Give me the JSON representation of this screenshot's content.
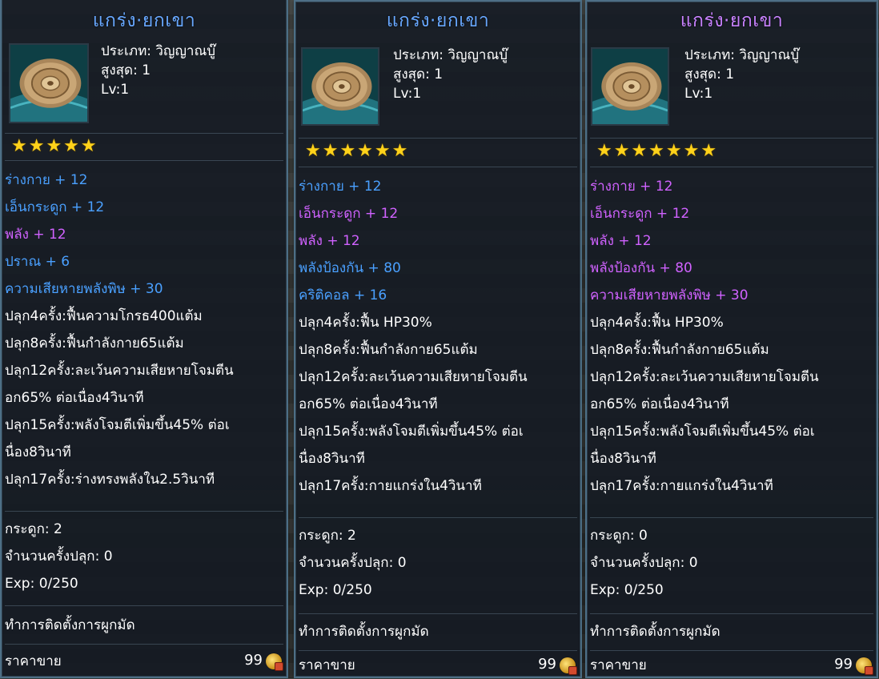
{
  "colors": {
    "blue": "#4aa0ff",
    "purple": "#d062ff",
    "white": "#ffffff",
    "star": "#ffd21a",
    "title_purple": "#c882ff",
    "title_blue": "#68a8ff"
  },
  "cards": [
    {
      "title": "แกร่ง·ยกเขา",
      "type": "ประเภท: วิญญาณบู๊",
      "max": "สูงสุด: 1",
      "level": "Lv:1",
      "stars": "★★★★★",
      "stats": [
        {
          "text": "ร่างกาย + 12",
          "color": "blue"
        },
        {
          "text": "เอ็นกระดูก + 12",
          "color": "blue"
        },
        {
          "text": "พลัง + 12",
          "color": "purple"
        },
        {
          "text": "ปราณ + 6",
          "color": "blue"
        },
        {
          "text": "ความเสียหายพลังพิษ + 30",
          "color": "blue"
        }
      ],
      "bonuses": [
        "ปลุก4ครั้ง:ฟื้นความโกรธ400แต้ม",
        "ปลุก8ครั้ง:ฟื้นกำลังกาย65แต้ม",
        "ปลุก12ครั้ง:ละเว้นความเสียหายโจมตีน",
        "อก65% ต่อเนื่อง4วินาที",
        "ปลุก15ครั้ง:พลังโจมตีเพิ่มขึ้น45% ต่อเ",
        "นื่อง8วินาที",
        "ปลุก17ครั้ง:ร่างทรงพลังใน2.5วินาที"
      ],
      "bone": "กระดูก: 2",
      "awaken_count": "จำนวนครั้งปลุก: 0",
      "exp": "Exp: 0/250",
      "bind": "ทำการติดตั้งการผูกมัด",
      "price_label": "ราคาขาย",
      "price": "99"
    },
    {
      "title": "แกร่ง·ยกเขา",
      "type": "ประเภท: วิญญาณบู๊",
      "max": "สูงสุด: 1",
      "level": "Lv:1",
      "stars": "★★★★★★",
      "stats": [
        {
          "text": "ร่างกาย + 12",
          "color": "blue"
        },
        {
          "text": "เอ็นกระดูก + 12",
          "color": "purple"
        },
        {
          "text": "พลัง + 12",
          "color": "purple"
        },
        {
          "text": "พลังป้องกัน + 80",
          "color": "blue"
        },
        {
          "text": "คริติคอล + 16",
          "color": "blue"
        }
      ],
      "bonuses": [
        "ปลุก4ครั้ง:ฟื้น HP30%",
        "ปลุก8ครั้ง:ฟื้นกำลังกาย65แต้ม",
        "ปลุก12ครั้ง:ละเว้นความเสียหายโจมตีน",
        "อก65% ต่อเนื่อง4วินาที",
        "ปลุก15ครั้ง:พลังโจมตีเพิ่มขึ้น45% ต่อเ",
        "นื่อง8วินาที",
        "ปลุก17ครั้ง:กายแกร่งใน4วินาที"
      ],
      "bone": "กระดูก: 2",
      "awaken_count": "จำนวนครั้งปลุก: 0",
      "exp": "Exp: 0/250",
      "bind": "ทำการติดตั้งการผูกมัด",
      "price_label": "ราคาขาย",
      "price": "99"
    },
    {
      "title": "แกร่ง·ยกเขา",
      "type": "ประเภท: วิญญาณบู๊",
      "max": "สูงสุด: 1",
      "level": "Lv:1",
      "stars": "★★★★★★★",
      "stats": [
        {
          "text": "ร่างกาย + 12",
          "color": "purple"
        },
        {
          "text": "เอ็นกระดูก + 12",
          "color": "purple"
        },
        {
          "text": "พลัง + 12",
          "color": "purple"
        },
        {
          "text": "พลังป้องกัน + 80",
          "color": "purple"
        },
        {
          "text": "ความเสียหายพลังพิษ + 30",
          "color": "purple"
        }
      ],
      "bonuses": [
        "ปลุก4ครั้ง:ฟื้น HP30%",
        "ปลุก8ครั้ง:ฟื้นกำลังกาย65แต้ม",
        "ปลุก12ครั้ง:ละเว้นความเสียหายโจมตีน",
        "อก65% ต่อเนื่อง4วินาที",
        "ปลุก15ครั้ง:พลังโจมตีเพิ่มขึ้น45% ต่อเ",
        "นื่อง8วินาที",
        "ปลุก17ครั้ง:กายแกร่งใน4วินาที"
      ],
      "bone": "กระดูก: 0",
      "awaken_count": "จำนวนครั้งปลุก: 0",
      "exp": "Exp: 0/250",
      "bind": "ทำการติดตั้งการผูกมัด",
      "price_label": "ราคาขาย",
      "price": "99"
    }
  ]
}
